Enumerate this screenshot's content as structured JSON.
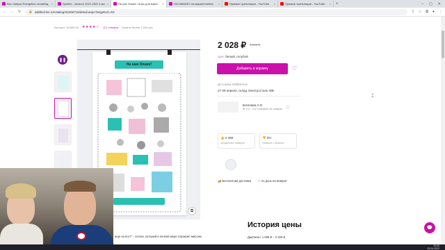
{
  "browser": {
    "tabs": [
      {
        "label": "Все товары Energetics на вайлд",
        "color": "#cb11ab"
      },
      {
        "label": "Spotlee - каталог 2021-2022 в мо",
        "color": "#cb11ab"
      },
      {
        "label": "На шаг ближе / игры для взрос",
        "color": "#cb11ab",
        "active": true
      },
      {
        "label": "RICHMANSY на маркетплейсе",
        "color": "#cb11ab"
      },
      {
        "label": "Прямые трансляции - YouTube",
        "color": "#ff0000"
      },
      {
        "label": "Прямые трансляции - YouTube",
        "color": "#ff0000"
      }
    ],
    "url": "wildberries.ru/catalog/32266715/detail.aspx?targetUrl=XS"
  },
  "product": {
    "article_label": "Артикул: 32266715",
    "stars": "★★★★☆",
    "reviews": "112 отзывов",
    "bought": "Купили более 2 400 раз",
    "banner_text": "На шаг ближе!",
    "price": "2 028 ₽",
    "old_price": "3 600 ₽",
    "color_label": "Цвет",
    "color_value": "белый, голубой",
    "cart_button": "Добавить в корзину",
    "delivery_label": "Доставка Wildberries",
    "delivery_value": "27-29 апреля, склад Электросталь WB",
    "seller_name": "Богачева А.О.",
    "seller_rating": "★ 4.4 · 112 отзывов на товары",
    "stat1_value": "2 398",
    "stat1_sub": "проданных товаров",
    "stat2_value": "0%",
    "stat2_sub": "товаров с браком",
    "feature1": "Бесплатная доставка",
    "feature2": "21 день на возврат",
    "history_title": "История цены",
    "range": "Диапазон: 1 599 ₽ – 2 028 ₽",
    "slogan": "ище на пост\" - слоган, который в полной мере отражает миссию"
  },
  "taskbar": {
    "time": "19:42",
    "date": "25.04.2022"
  },
  "colors": {
    "accent": "#cb11ab",
    "brand_dark": "#6d1e8b"
  }
}
